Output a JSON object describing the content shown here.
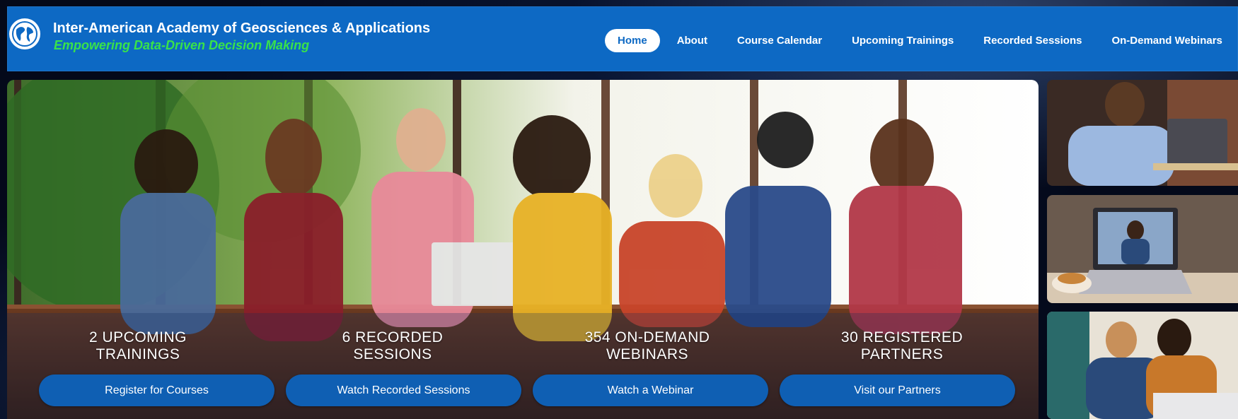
{
  "brand": {
    "title": "Inter-American Academy of Geosciences & Applications",
    "subtitle": "Empowering Data-Driven Decision Making",
    "logo_icon": "globe-icon"
  },
  "nav": {
    "items": [
      {
        "label": "Home",
        "active": true
      },
      {
        "label": "About",
        "active": false
      },
      {
        "label": "Course Calendar",
        "active": false
      },
      {
        "label": "Upcoming Trainings",
        "active": false
      },
      {
        "label": "Recorded Sessions",
        "active": false
      },
      {
        "label": "On-Demand Webinars",
        "active": false
      }
    ]
  },
  "hero": {
    "stats": [
      {
        "line1": "2 UPCOMING",
        "line2": "TRAININGS"
      },
      {
        "line1": "6 RECORDED",
        "line2": "SESSIONS"
      },
      {
        "line1": "354 ON-DEMAND",
        "line2": "WEBINARS"
      },
      {
        "line1": "30 REGISTERED",
        "line2": "PARTNERS"
      }
    ],
    "buttons": [
      {
        "label": "Register for Courses"
      },
      {
        "label": "Watch Recorded Sessions"
      },
      {
        "label": "Watch a Webinar"
      },
      {
        "label": "Visit our Partners"
      }
    ]
  },
  "colors": {
    "header_blue": "#0d69c4",
    "subtitle_green": "#39e24a",
    "button_blue": "#0f5fb3"
  }
}
